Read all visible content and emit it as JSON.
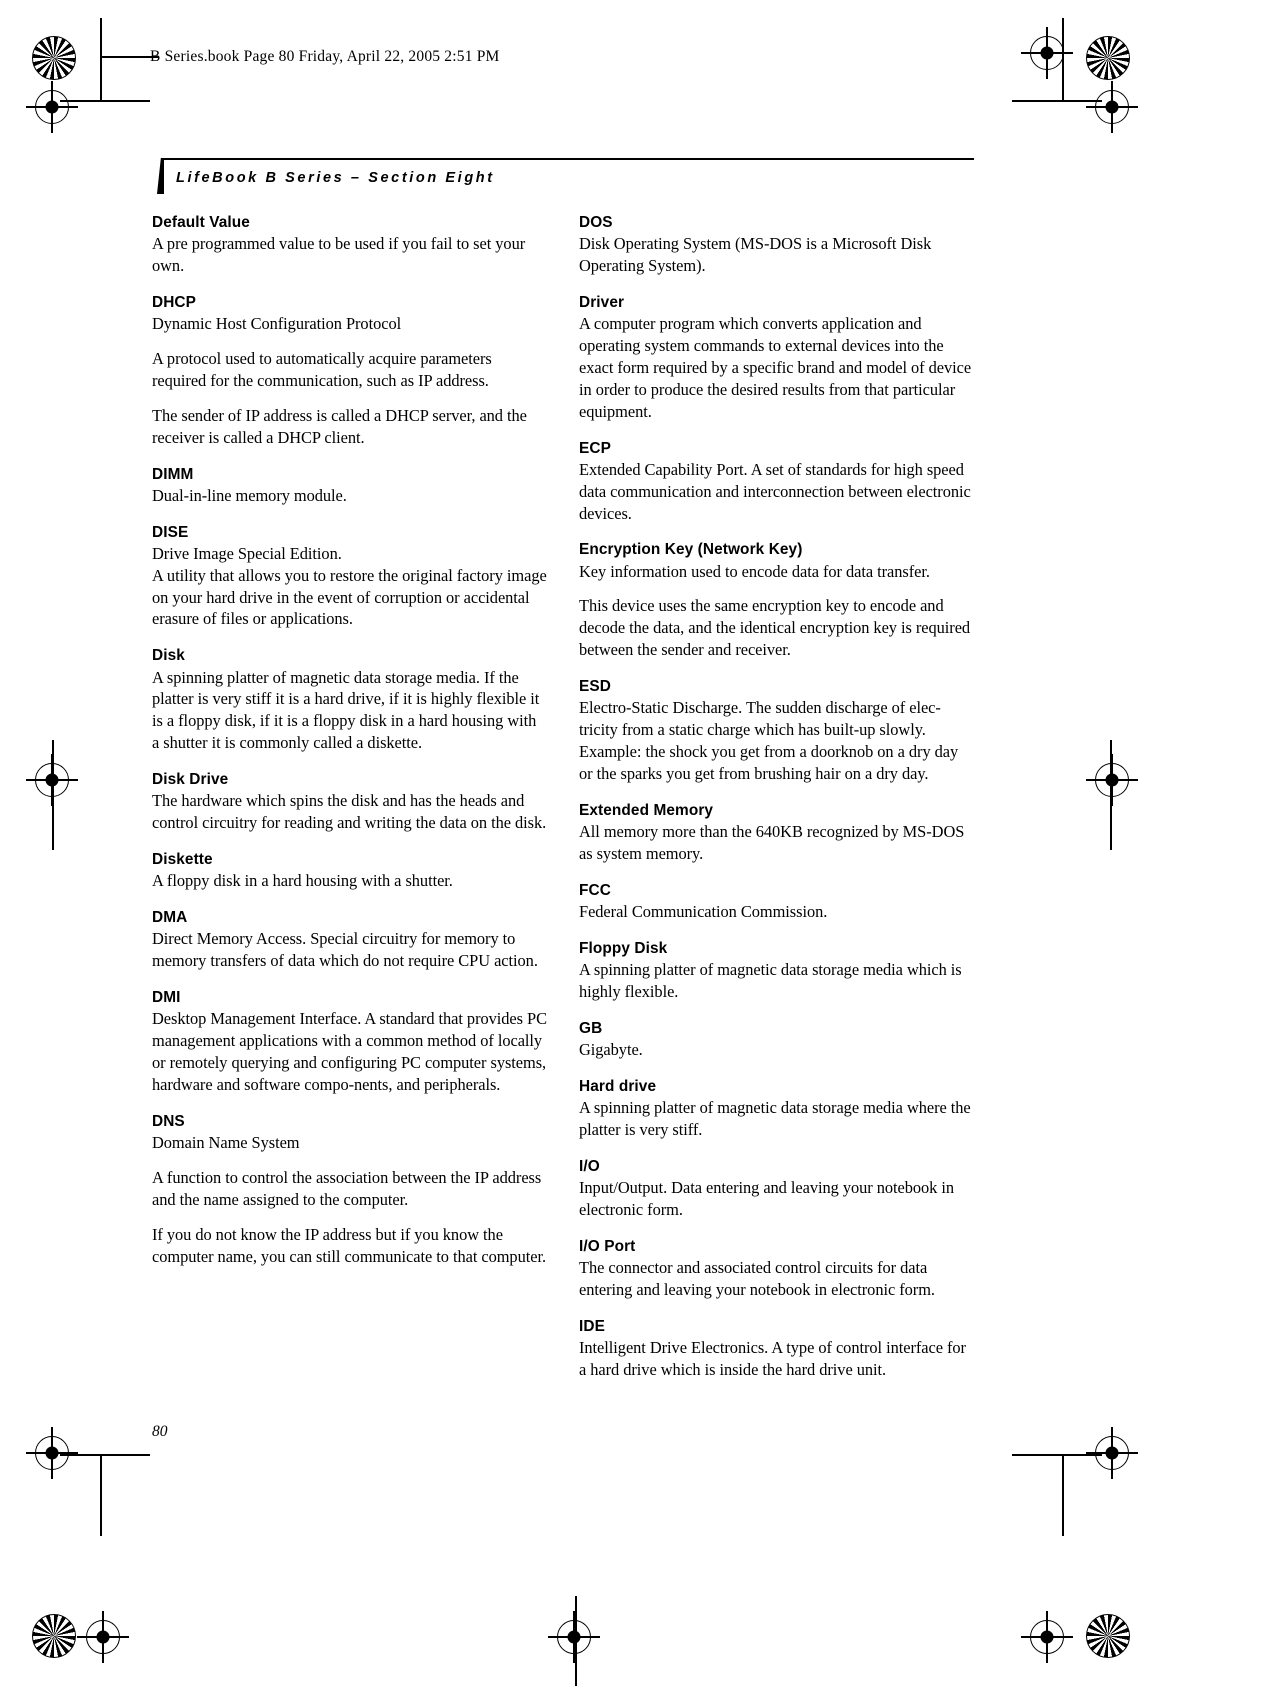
{
  "slug": "B Series.book  Page 80  Friday, April 22, 2005  2:51 PM",
  "running_head": "LifeBook B Series – Section Eight",
  "folio": "80",
  "columns": [
    {
      "entries": [
        {
          "term": "Default Value",
          "paragraphs": [
            "A pre programmed value to be used if you fail to set your own."
          ]
        },
        {
          "term": "DHCP",
          "paragraphs": [
            "Dynamic Host Configuration Protocol",
            "A protocol used to automatically acquire parameters required for the communication, such as IP address.",
            "The sender of IP address is called a DHCP server, and the receiver is called a DHCP client."
          ]
        },
        {
          "term": "DIMM",
          "paragraphs": [
            "Dual-in-line memory module."
          ]
        },
        {
          "term": "DISE",
          "paragraphs": [
            "Drive Image Special Edition.\nA utility that allows you to restore the original factory image on your hard drive in the event of corruption or accidental erasure of files or applications."
          ]
        },
        {
          "term": "Disk",
          "paragraphs": [
            "A spinning platter of magnetic data storage media. If the platter is very stiff it is a hard drive, if it is highly flexible it is a floppy disk, if it is a floppy disk in a hard housing with a shutter it is commonly called a diskette."
          ]
        },
        {
          "term": "Disk Drive",
          "paragraphs": [
            "The hardware which spins the disk and has the heads and control circuitry for reading and writing the data on the disk."
          ]
        },
        {
          "term": "Diskette",
          "paragraphs": [
            "A floppy disk in a hard housing with a shutter."
          ]
        },
        {
          "term": "DMA",
          "paragraphs": [
            "Direct Memory Access. Special circuitry for memory to memory transfers of data which do not require CPU action."
          ]
        },
        {
          "term": "DMI",
          "paragraphs": [
            "Desktop Management Interface. A standard that provides PC management applications with a common method of locally or remotely querying and configuring PC computer systems, hardware and software compo-nents, and peripherals."
          ]
        },
        {
          "term": "DNS",
          "paragraphs": [
            "Domain Name System",
            "A function to control the association between the IP address and the name assigned to the computer.",
            "If you do not know the IP address but if you know the computer name, you can still communicate to that computer."
          ]
        }
      ]
    },
    {
      "entries": [
        {
          "term": "DOS",
          "paragraphs": [
            "Disk Operating System (MS-DOS is a Microsoft Disk Operating System)."
          ]
        },
        {
          "term": "Driver",
          "paragraphs": [
            "A computer program which converts application and operating system commands to external devices into the exact form required by a specific brand and model of device in order to produce the desired results from that particular equipment."
          ]
        },
        {
          "term": "ECP",
          "paragraphs": [
            "Extended Capability Port. A set of standards for high speed data communication and interconnection between electronic devices."
          ]
        },
        {
          "term": "Encryption Key (Network Key)",
          "paragraphs": [
            "Key information used to encode data for data transfer.",
            "This device uses the same encryption key to encode and decode the data, and the identical encryption key is required between the sender and receiver."
          ]
        },
        {
          "term": "ESD",
          "paragraphs": [
            "Electro-Static Discharge. The sudden discharge of elec-tricity from a static charge which has built-up slowly. Example: the shock you get from a doorknob on a dry day or the sparks you get from brushing hair on a dry day."
          ]
        },
        {
          "term": "Extended Memory",
          "paragraphs": [
            "All memory more than the 640KB recognized by MS-DOS as system memory."
          ]
        },
        {
          "term": "FCC",
          "paragraphs": [
            "Federal Communication Commission."
          ]
        },
        {
          "term": "Floppy Disk",
          "paragraphs": [
            "A spinning platter of magnetic data storage media which is highly flexible."
          ]
        },
        {
          "term": "GB",
          "paragraphs": [
            "Gigabyte."
          ]
        },
        {
          "term": "Hard drive",
          "paragraphs": [
            "A spinning platter of magnetic data storage media where the platter is very stiff."
          ]
        },
        {
          "term": "I/O",
          "paragraphs": [
            "Input/Output. Data entering and leaving your notebook in electronic form."
          ]
        },
        {
          "term": "I/O Port",
          "paragraphs": [
            "The connector and associated control circuits for data entering and leaving your notebook in electronic form."
          ]
        },
        {
          "term": "IDE",
          "paragraphs": [
            "Intelligent Drive Electronics. A type of control interface for a hard drive which is inside the hard drive unit."
          ]
        }
      ]
    }
  ]
}
